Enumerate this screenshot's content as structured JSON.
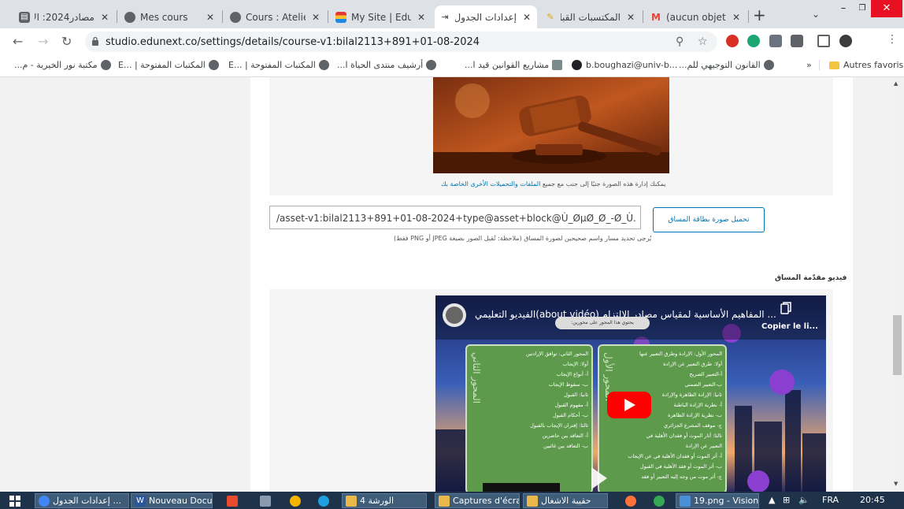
{
  "browser": {
    "tabs": [
      {
        "title": "مصادر2024: الإ",
        "active": false
      },
      {
        "title": "Mes cours",
        "active": false
      },
      {
        "title": "Cours : Atelier S",
        "active": false
      },
      {
        "title": "My Site | Edune",
        "active": false
      },
      {
        "title": "إعدادات الجدول",
        "active": true
      },
      {
        "title": "المكتسبات القبل",
        "active": false
      },
      {
        "title": "(aucun objet) -",
        "active": false
      }
    ],
    "url": "studio.edunext.co/settings/details/course-v1:bilal2113+891+01-08-2024",
    "bookmarks": [
      "مكتبة نور الخيرية - م...",
      "المكتبات المفتوحة | ...E",
      "المكتبات المفتوحة | ...E",
      "أرشيف منتدى الحياة ا...",
      "مشاريع القوانين قيد ا...",
      "b.boughazi@univ-b...",
      "القانون التوجيهي للم..."
    ],
    "bookmarks_overflow": "»",
    "other_bookmarks": "Autres favoris"
  },
  "page": {
    "image_caption_prefix": "يمكنك إدارة هذه الصورة جنبًا إلى جنب مع جميع",
    "image_caption_link": "الملفات والتحميلات الأخرى الخاصة بك",
    "asset_path": "/asset-v1:bilal2113+891+01-08-2024+type@asset+block@Ù_ØµØ_Ø_-Ø_Ù.",
    "upload_button": "تحميل صورة بطاقة المساق",
    "help_text": "يُرجى تحديد مسار واسم صحيحين لصورة المساق (ملاحظة: تُقبل الصور بصيغة JPEG أو PNG فقط)",
    "video_heading": "فيديو مقدّمة المساق"
  },
  "video": {
    "title": "... المفاهيم الأساسية لمقياس مصادر الالتزام (about vidéo)الفيديو التعليمي",
    "subtitle": "يحتوي هذا المحور على محورين:",
    "copy_label": "Copier le li...",
    "card_right_vertical": "المحور الأول",
    "card_right_lines": [
      "المحور الأول: الإرادة وطرق التعبير عنها",
      "أولا: طرق التعبير عن الإرادة",
      "أ-التعبير الصريح",
      "ب-التعبير الضمني",
      "ثانيا: الإرادة الظاهرة والإرادة",
      "أ- نظرية الإرادة الباطنة",
      "ب- نظرية الإرادة الظاهرة",
      "ج- موقف المشرع الجزائري",
      "ثالثا: أثار الموت أو فقدان الأهلية في",
      "التعبير عن الإرادة",
      "أ- أثر الموت أو فقدان الأهلية في عن الإيجاب",
      "ب- أثر الموت أو فقد الأهلية في القبول",
      "ج- أثر موت من وجه إليه التعبير أو فقد"
    ],
    "card_left_vertical": "المحور الثاني",
    "card_left_lines": [
      "المحور الثاني: توافق الإرادتين",
      "أولا: الإيجاب",
      "أ- أنواع الإيجاب",
      "ب- سقوط الإيجاب",
      "ثانيا: القبول",
      "أ- مفهوم القبول",
      "ب- أحكام القبول",
      "ثالثا: إقتران الإيجاب بالقبول",
      "أ- التعاقد بين حاضرين",
      "ب- التعاقد بين غائبين"
    ]
  },
  "taskbar": {
    "items": [
      "إعدادات الجدول ...",
      "Nouveau Docu...",
      "الورشة 4",
      "Captures d'écran",
      "حقيبة الاشغال",
      "19.png - Vision..."
    ],
    "language": "FRA",
    "time": "20:45"
  }
}
